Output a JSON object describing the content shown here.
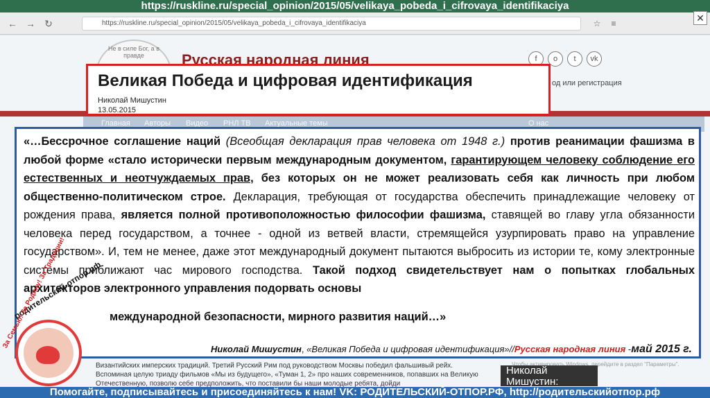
{
  "banner_url": "https://ruskline.ru/special_opinion/2015/05/velikaya_pobeda_i_cifrovaya_identifikaciya",
  "browser": {
    "address": "https://ruskline.ru/special_opinion/2015/05/velikaya_pobeda_i_cifrovaya_identifikaciya",
    "back_icon": "arrow-left-icon",
    "forward_icon": "arrow-right-icon",
    "reload_icon": "reload-icon"
  },
  "site": {
    "logo_text": "Не в силе Бог, а в правде",
    "title": "Русская народная линия",
    "social_icons": [
      "facebook-icon",
      "odnoklassniki-icon",
      "twitter-icon",
      "vk-icon"
    ],
    "reg_link": "од или регистрация",
    "nav": [
      "Главная",
      "Авторы",
      "Видео",
      "РНЛ ТВ",
      "Актуальные темы",
      "О нас"
    ]
  },
  "article": {
    "headline": "Великая Победа и цифровая идентификация",
    "author": "Николай Мишустин",
    "date": "13.05.2015"
  },
  "quote": {
    "p1": "«…Бессрочное соглашение наций",
    "p2": "(Всеобщая декларация прав человека от 1948 г.)",
    "p3": "против реанимации фашизма в любой форме «стало исторически первым международным документом,",
    "p4": "гарантирующем человеку соблюдение его естественных и неотчуждаемых прав,",
    "p5": "без которых он не может реализовать себя как личность при любом общественно-политическом строе.",
    "p6": "Декларация, требующая от государства обеспечить принадлежащие человеку от рождения права,",
    "p7": "является полной противоположностью философии фашизма,",
    "p8": "ставящей во главу угла обязанности человека перед государством, а точнее - одной из ветвей власти, стремящейся узурпировать право на управление государством». И, тем не менее, даже этот международный документ пытаются выбросить из истории те, кому электронные системы приближают час мирового господства.",
    "p9": "Такой подход свидетельствует нам о попытках глобальных архитекторов электронного управления подорвать основы",
    "p10": "международной безопасности, мирного развития наций…»"
  },
  "attribution": {
    "name": "Николай Мишустин",
    "sep1": ", ",
    "source": "«Великая Победа и цифровая идентификация»//",
    "outlet": "Русская народная линия",
    "sep2": " -",
    "date": "май 2015 г."
  },
  "below": {
    "text": "Византийских имперских традиций. Третий Русский Рим под руководством Москвы победил фальшивый рейх. Вспоминая целую триаду фильмов «Мы из будущего», «Туман 1, 2» про наших современников, попавших на Великую Отечественную, позволю себе предположить, что поставили бы наши молодые ребята, дойди",
    "activate": "Чтобы активировать Windows, перейдите в раздел \"Параметры\".",
    "card": "Николай Мишустин:"
  },
  "parent_logo": {
    "top_text": "родительский-отпор.рф",
    "side_text": "За Семью! За Родину! За Традиции!"
  },
  "bottom_banner": "Помогайте, подписывайтесь и присоединяйтесь к нам! VK: РОДИТЕЛЬСКИЙ-ОТПОР.РФ, http://родительскийотпор.рф"
}
